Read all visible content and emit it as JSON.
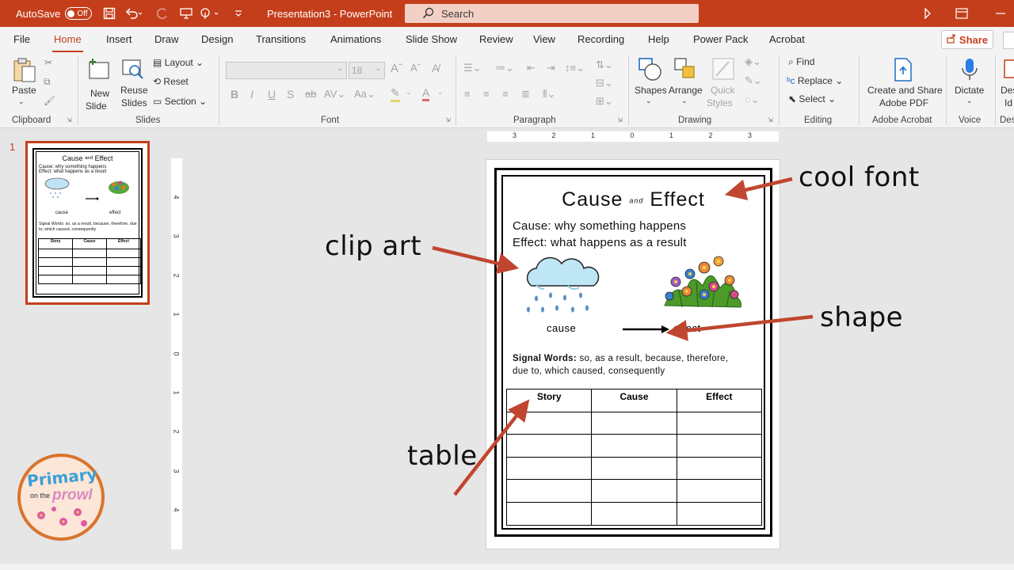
{
  "titlebar": {
    "autosave_label": "AutoSave",
    "autosave_state": "Off",
    "title": "Presentation3 - PowerPoint",
    "search_placeholder": "Search"
  },
  "tabs": [
    "File",
    "Home",
    "Insert",
    "Draw",
    "Design",
    "Transitions",
    "Animations",
    "Slide Show",
    "Review",
    "View",
    "Recording",
    "Help",
    "Power Pack",
    "Acrobat"
  ],
  "active_tab": "Home",
  "share_label": "Share",
  "ribbon": {
    "clipboard": {
      "label": "Clipboard",
      "paste": "Paste"
    },
    "slides": {
      "label": "Slides",
      "new_slide_1": "New",
      "new_slide_2": "Slide",
      "reuse_1": "Reuse",
      "reuse_2": "Slides",
      "layout": "Layout",
      "reset": "Reset",
      "section": "Section"
    },
    "font": {
      "label": "Font",
      "size": "18"
    },
    "paragraph": {
      "label": "Paragraph"
    },
    "drawing": {
      "label": "Drawing",
      "shapes": "Shapes",
      "arrange": "Arrange",
      "quick_1": "Quick",
      "quick_2": "Styles"
    },
    "editing": {
      "label": "Editing",
      "find": "Find",
      "replace": "Replace",
      "select": "Select"
    },
    "acrobat": {
      "label": "Adobe Acrobat",
      "create_1": "Create and Share",
      "create_2": "Adobe PDF"
    },
    "voice": {
      "label": "Voice",
      "dictate": "Dictate"
    },
    "designer": {
      "label": "Des",
      "btn_1": "Desi",
      "btn_2": "Id"
    }
  },
  "thumbnail": {
    "number": "1",
    "title": "Cause ᵃⁿᵈ Effect",
    "line1": "Cause: why something happens",
    "line2": "Effect: what happens as a result",
    "cause": "cause",
    "effect": "effect",
    "signal": "Signal Words: so, as a result, because, therefore, due to, which caused, consequently",
    "cols": [
      "Story",
      "Cause",
      "Effect"
    ]
  },
  "ruler_h_ticks": [
    "3",
    "2",
    "1",
    "0",
    "1",
    "2",
    "3"
  ],
  "ruler_v_ticks": [
    "4",
    "3",
    "2",
    "1",
    "0",
    "1",
    "2",
    "3",
    "4"
  ],
  "slide": {
    "title_cause": "Cause",
    "title_and": "and",
    "title_effect": "Effect",
    "line1": "Cause: why something happens",
    "line2": "Effect: what happens as a result",
    "cause_label": "cause",
    "effect_label": "effect",
    "signal_bold": "Signal Words:",
    "signal_rest": " so, as a result, because, therefore, due to, which caused, consequently",
    "table_headers": [
      "Story",
      "Cause",
      "Effect"
    ]
  },
  "annotations": {
    "cool_font": "cool font",
    "clip_art": "clip art",
    "shape": "shape",
    "table": "table"
  },
  "logo": {
    "line1": "Primary",
    "line2": "on the",
    "line3": "prowl"
  },
  "colors": {
    "accent": "#c43e1c",
    "arrow": "#c0462f"
  }
}
